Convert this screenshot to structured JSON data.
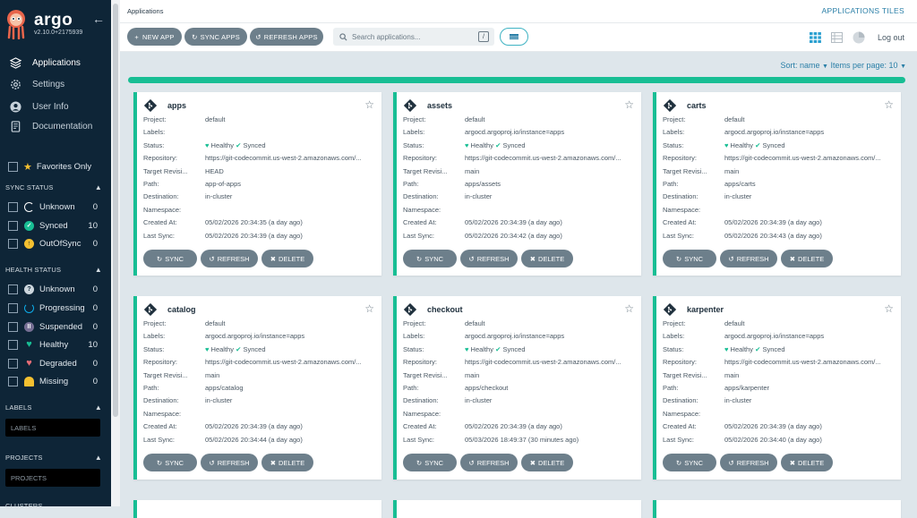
{
  "sidebar": {
    "brand": "argo",
    "version": "v2.10.0+2175939",
    "nav": [
      {
        "label": "Applications",
        "icon": "layers-icon"
      },
      {
        "label": "Settings",
        "icon": "gear-icon"
      },
      {
        "label": "User Info",
        "icon": "user-icon"
      },
      {
        "label": "Documentation",
        "icon": "book-icon"
      }
    ],
    "favorites_label": "Favorites Only",
    "sync_status": {
      "title": "SYNC STATUS",
      "items": [
        {
          "label": "Unknown",
          "count": "0",
          "color": "#ffffff"
        },
        {
          "label": "Synced",
          "count": "10",
          "color": "#18be94"
        },
        {
          "label": "OutOfSync",
          "count": "0",
          "color": "#f4c030"
        }
      ]
    },
    "health_status": {
      "title": "HEALTH STATUS",
      "items": [
        {
          "label": "Unknown",
          "count": "0",
          "color": "#ccd6dd"
        },
        {
          "label": "Progressing",
          "count": "0",
          "color": "#0dadea"
        },
        {
          "label": "Suspended",
          "count": "0",
          "color": "#766f94"
        },
        {
          "label": "Healthy",
          "count": "10",
          "color": "#18be94"
        },
        {
          "label": "Degraded",
          "count": "0",
          "color": "#e96d76"
        },
        {
          "label": "Missing",
          "count": "0",
          "color": "#f4c030"
        }
      ]
    },
    "labels": {
      "title": "LABELS",
      "placeholder": "LABELS"
    },
    "projects": {
      "title": "PROJECTS",
      "placeholder": "PROJECTS"
    },
    "clusters": {
      "title": "CLUSTERS"
    }
  },
  "topbar": {
    "breadcrumb": "Applications",
    "view_title": "APPLICATIONS TILES"
  },
  "toolbar": {
    "new_app": "NEW APP",
    "sync_apps": "SYNC APPS",
    "refresh_apps": "REFRESH APPS",
    "search_placeholder": "Search applications...",
    "search_shortcut": "/",
    "logout": "Log out"
  },
  "sort": {
    "label": "Sort: name",
    "per_page": "Items per page: 10"
  },
  "field_labels": {
    "project": "Project:",
    "labels": "Labels:",
    "status": "Status:",
    "repository": "Repository:",
    "target": "Target Revisi...",
    "path": "Path:",
    "destination": "Destination:",
    "namespace": "Namespace:",
    "created": "Created At:",
    "lastsync": "Last Sync:"
  },
  "status": {
    "health": "Healthy",
    "sync": "Synced"
  },
  "card_buttons": {
    "sync": "SYNC",
    "refresh": "REFRESH",
    "delete": "DELETE"
  },
  "apps": [
    {
      "name": "apps",
      "project": "default",
      "labels": "",
      "repo": "https://git-codecommit.us-west-2.amazonaws.com/...",
      "target": "HEAD",
      "path": "app-of-apps",
      "destination": "in-cluster",
      "namespace": "",
      "created": "05/02/2026 20:34:35  (a day ago)",
      "lastsync": "05/02/2026 20:34:39  (a day ago)"
    },
    {
      "name": "assets",
      "project": "default",
      "labels": "argocd.argoproj.io/instance=apps",
      "repo": "https://git-codecommit.us-west-2.amazonaws.com/...",
      "target": "main",
      "path": "apps/assets",
      "destination": "in-cluster",
      "namespace": "",
      "created": "05/02/2026 20:34:39  (a day ago)",
      "lastsync": "05/02/2026 20:34:42  (a day ago)"
    },
    {
      "name": "carts",
      "project": "default",
      "labels": "argocd.argoproj.io/instance=apps",
      "repo": "https://git-codecommit.us-west-2.amazonaws.com/...",
      "target": "main",
      "path": "apps/carts",
      "destination": "in-cluster",
      "namespace": "",
      "created": "05/02/2026 20:34:39  (a day ago)",
      "lastsync": "05/02/2026 20:34:43  (a day ago)"
    },
    {
      "name": "catalog",
      "project": "default",
      "labels": "argocd.argoproj.io/instance=apps",
      "repo": "https://git-codecommit.us-west-2.amazonaws.com/...",
      "target": "main",
      "path": "apps/catalog",
      "destination": "in-cluster",
      "namespace": "",
      "created": "05/02/2026 20:34:39  (a day ago)",
      "lastsync": "05/02/2026 20:34:44  (a day ago)"
    },
    {
      "name": "checkout",
      "project": "default",
      "labels": "argocd.argoproj.io/instance=apps",
      "repo": "https://git-codecommit.us-west-2.amazonaws.com/...",
      "target": "main",
      "path": "apps/checkout",
      "destination": "in-cluster",
      "namespace": "",
      "created": "05/02/2026 20:34:39  (a day ago)",
      "lastsync": "05/03/2026 18:49:37  (30 minutes ago)"
    },
    {
      "name": "karpenter",
      "project": "default",
      "labels": "argocd.argoproj.io/instance=apps",
      "repo": "https://git-codecommit.us-west-2.amazonaws.com/...",
      "target": "main",
      "path": "apps/karpenter",
      "destination": "in-cluster",
      "namespace": "",
      "created": "05/02/2026 20:34:39  (a day ago)",
      "lastsync": "05/02/2026 20:34:40  (a day ago)"
    }
  ],
  "colors": {
    "accent": "#18be94",
    "sidebar_bg": "#0e2537",
    "link": "#2a7fa7",
    "button": "#6d7f8b"
  }
}
